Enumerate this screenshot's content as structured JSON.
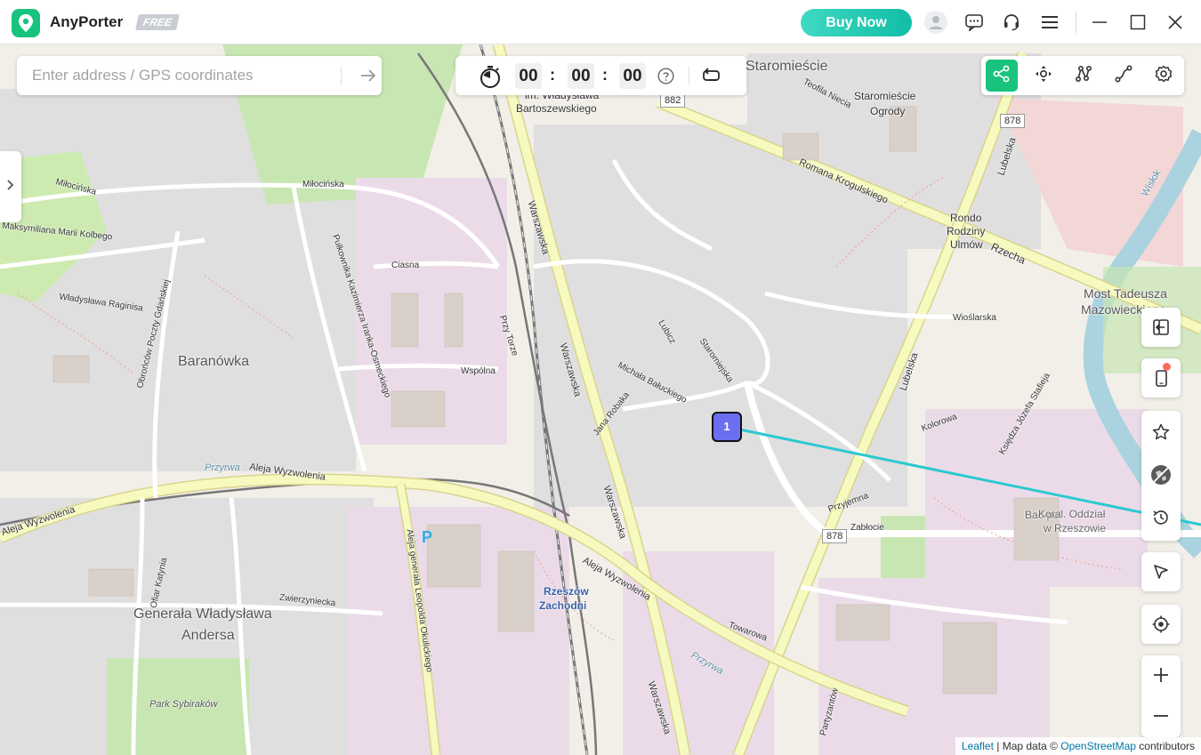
{
  "app": {
    "name": "AnyPorter",
    "badge": "FREE",
    "buy_label": "Buy Now"
  },
  "titlebar": {
    "icons": [
      "user-icon",
      "feedback-icon",
      "support-icon",
      "menu-icon",
      "minimize-icon",
      "maximize-icon",
      "close-icon"
    ]
  },
  "search": {
    "placeholder": "Enter address / GPS coordinates",
    "go_icon": "arrow-right-icon"
  },
  "timer": {
    "hours": "00",
    "minutes": "00",
    "seconds": "00",
    "icons": [
      "stopwatch-icon",
      "help-icon",
      "repeat-icon"
    ]
  },
  "modes": {
    "items": [
      {
        "name": "multi-spot-mode",
        "icon": "share-nodes-icon",
        "active": true
      },
      {
        "name": "joystick-mode",
        "icon": "joystick-icon",
        "active": false
      },
      {
        "name": "multi-stop-route-mode",
        "icon": "route-icon",
        "active": false
      },
      {
        "name": "two-spot-mode",
        "icon": "two-spot-icon",
        "active": false
      },
      {
        "name": "settings",
        "icon": "gear-icon",
        "active": false
      }
    ]
  },
  "side_panel": {
    "items": [
      "exit-icon",
      "device-icon",
      "favorite-star-icon",
      "no-gps-icon",
      "history-icon",
      "cursor-icon",
      "locate-icon",
      "zoom-in-icon",
      "zoom-out-icon"
    ]
  },
  "marker": {
    "label": "1",
    "accent": "#6b6ef0",
    "route_color": "#2cc9d1"
  },
  "colors": {
    "primary": "#19c37d",
    "buy_gradient_start": "#3fd9c3",
    "buy_gradient_end": "#12bda6"
  },
  "map": {
    "labels": {
      "staromiescie_top": "Staromieście",
      "wladyslawa": "im. Władysława",
      "bartoszewskiego": "Bartoszewskiego",
      "staromiescie_ogrody_1": "Staromieście",
      "staromiescie_ogrody_2": "Ogrody",
      "teofila": "Teofila Niecia",
      "romana": "Romana Kroguls​kiego",
      "rondo_1": "Rondo",
      "rondo_2": "Rodziny",
      "rondo_3": "Ulmów",
      "rzecha": "Rzecha",
      "most_1": "Most Tadeusza",
      "most_2": "Mazowieckiego",
      "wislok": "Wisłok",
      "lubelska_top": "Lubelska",
      "wioslarska": "Wioślarska",
      "lubelska_mid": "Lubelska",
      "milocinska": "Miłocińska",
      "milocinska_2": "Miłocińska",
      "maksymiliana": "Maksymiliana Marii Kolbego",
      "wladyslawa_raginisa": "Władysława Raginisa",
      "baranowka": "Baranówka",
      "ciasna": "Ciasna",
      "wspolna": "Wspólna",
      "warszawska_1": "Warszawska",
      "warszawska_2": "Warszawska",
      "warszawska_3": "Warszawska",
      "warszawska_4": "Warszawska",
      "przy_torze": "Przy Torze",
      "aleja_wyzwolenia_1": "Aleja Wyzwolenia",
      "aleja_wyzwolenia_2": "Aleja Wyzwolenia",
      "aleja_wyzwolenia_3": "Aleja Wyzwolenia",
      "przyrwa": "Przyrwa",
      "przyrwa_2": "Przyrwa",
      "generala_1": "Generała Władysława",
      "generala_2": "Andersa",
      "park_sybirakow": "Park Sybiraków",
      "rzeszow_1": "Rzeszów",
      "rzeszow_2": "Zachodni",
      "zwierzyniecka": "Zwierzyniecka",
      "towarowa": "Towarowa",
      "bac_pol": "Bać-pol",
      "koral_1": "Koral. Oddział",
      "koral_2": "w Rzeszowie",
      "zablocie": "Zabłocie",
      "kolorowa": "Kolorowa",
      "przyjemna": "Przyjemna",
      "staromiejska": "Staromiejska",
      "lubicz": "Lubicz",
      "jana_robaka": "Jana Robaka",
      "michala": "Michała Bałuckiego",
      "ofiar_katynia": "Ofiar Katynia",
      "leopolda": "Aleja generała Leopolda Okulickiego",
      "kazimierza": "Pułkownika Kazimierza Iranka-Osmeckiego",
      "obroncow": "Obrońców Poczty Gdańskiej",
      "partyzantow": "Partyzantów",
      "ksiedza": "Księdza Józefa Stafieja"
    },
    "shields": {
      "s882": "882",
      "s878_top": "878",
      "s878_mid": "878"
    }
  },
  "attribution": {
    "leaflet": "Leaflet",
    "sep": " | Map data © ",
    "osm": "OpenStreetMap",
    "suffix": " contributors"
  }
}
